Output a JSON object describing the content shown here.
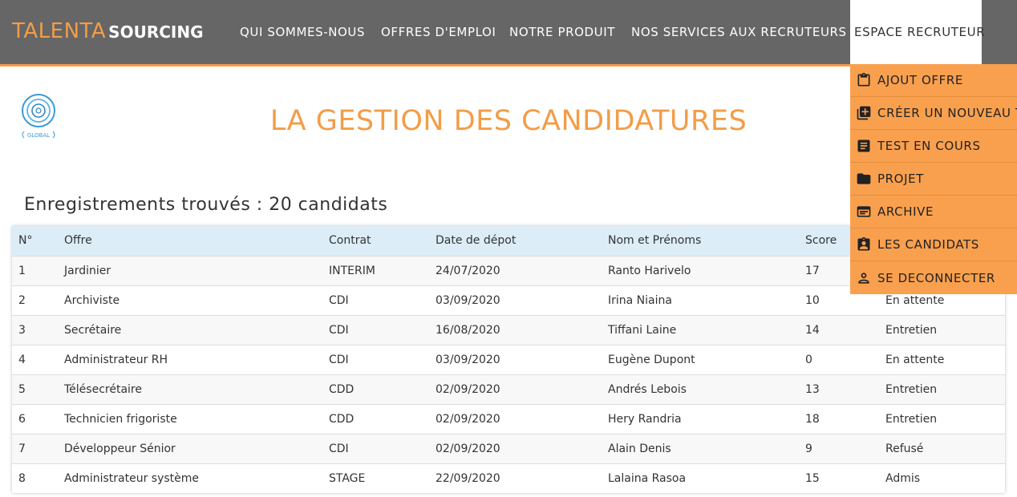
{
  "brand": {
    "part1": "TALENTA",
    "part2": "SOURCING"
  },
  "nav": {
    "items": [
      "QUI SOMMES-NOUS",
      "OFFRES D'EMPLOI",
      "NOTRE PRODUIT",
      "NOS SERVICES AUX RECRUTEURS"
    ],
    "active": "ESPACE RECRUTEUR"
  },
  "dropdown": {
    "items": [
      {
        "label": "AJOUT OFFRE",
        "icon": "clipboard-icon"
      },
      {
        "label": "CRÉER UN NOUVEAU TEST",
        "icon": "add-box-icon"
      },
      {
        "label": "TEST EN COURS",
        "icon": "document-icon"
      },
      {
        "label": "PROJET",
        "icon": "folder-icon"
      },
      {
        "label": "ARCHIVE",
        "icon": "archive-icon"
      },
      {
        "label": "LES CANDIDATS",
        "icon": "badge-icon"
      },
      {
        "label": "SE DECONNECTER",
        "icon": "person-icon"
      }
    ]
  },
  "logo": {
    "text": "GLOBAL"
  },
  "page": {
    "title": "LA GESTION DES CANDIDATURES",
    "count": "Enregistrements trouvés : 20 candidats"
  },
  "table": {
    "headers": [
      "N°",
      "Offre",
      "Contrat",
      "Date de dépot",
      "Nom et Prénoms",
      "Score",
      ""
    ],
    "rows": [
      [
        "1",
        "Jardinier",
        "INTERIM",
        "24/07/2020",
        "Ranto Harivelo",
        "17",
        ""
      ],
      [
        "2",
        "Archiviste",
        "CDI",
        "03/09/2020",
        "Irina Niaina",
        "10",
        "En attente"
      ],
      [
        "3",
        "Secrétaire",
        "CDI",
        "16/08/2020",
        "Tiffani Laine",
        "14",
        "Entretien"
      ],
      [
        "4",
        "Administrateur RH",
        "CDI",
        "03/09/2020",
        "Eugène Dupont",
        "0",
        "En attente"
      ],
      [
        "5",
        "Télésecrétaire",
        "CDD",
        "02/09/2020",
        "Andrés Lebois",
        "13",
        "Entretien"
      ],
      [
        "6",
        "Technicien frigoriste",
        "CDD",
        "02/09/2020",
        "Hery Randria",
        "18",
        "Entretien"
      ],
      [
        "7",
        "Développeur Sénior",
        "CDI",
        "02/09/2020",
        "Alain Denis",
        "9",
        "Refusé"
      ],
      [
        "8",
        "Administrateur système",
        "STAGE",
        "22/09/2020",
        "Lalaina Rasoa",
        "15",
        "Admis"
      ]
    ]
  },
  "colors": {
    "accent": "#f29d48",
    "header_bg": "#666666",
    "dropdown_bg": "#f9a04e",
    "table_header_bg": "#dcedf7"
  }
}
